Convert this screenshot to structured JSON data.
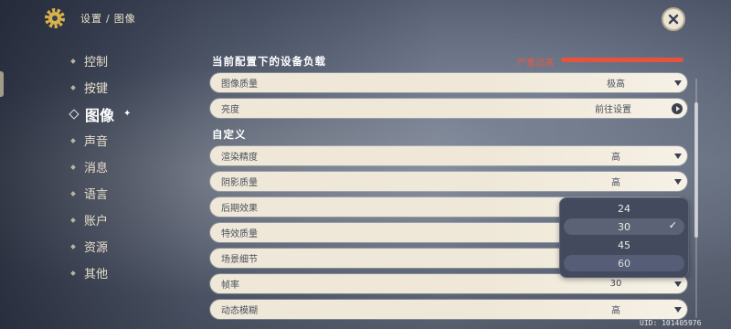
{
  "header": {
    "breadcrumb": [
      "设置",
      "图像"
    ],
    "separator": "/"
  },
  "nav": {
    "items": [
      {
        "label": "控制"
      },
      {
        "label": "按键"
      },
      {
        "label": "图像",
        "active": true
      },
      {
        "label": "声音"
      },
      {
        "label": "消息"
      },
      {
        "label": "语言"
      },
      {
        "label": "账户"
      },
      {
        "label": "资源"
      },
      {
        "label": "其他"
      }
    ]
  },
  "device_load": {
    "title": "当前配置下的设备负载",
    "status": "严重过高",
    "color": "#e5533f"
  },
  "settings": [
    {
      "label": "图像质量",
      "value": "极高",
      "control": "dropdown"
    },
    {
      "label": "亮度",
      "value": "前往设置",
      "control": "go"
    }
  ],
  "custom": {
    "title": "自定义",
    "rows": [
      {
        "label": "渲染精度",
        "value": "高",
        "control": "dropdown"
      },
      {
        "label": "阴影质量",
        "value": "高",
        "control": "dropdown"
      },
      {
        "label": "后期效果",
        "value": "",
        "control": "dropdown"
      },
      {
        "label": "特效质量",
        "value": "",
        "control": "dropdown"
      },
      {
        "label": "场景细节",
        "value": "",
        "control": "dropdown"
      },
      {
        "label": "帧率",
        "value": "30",
        "control": "dropdown"
      },
      {
        "label": "动态模糊",
        "value": "高",
        "control": "dropdown"
      }
    ]
  },
  "framerate_dropdown": {
    "options": [
      "24",
      "30",
      "45",
      "60"
    ],
    "selected": "30",
    "highlighted": "60"
  },
  "footer": {
    "uid": "UID: 101405976"
  },
  "icons": {
    "settings": "gear-icon",
    "close": "close-icon",
    "check": "checkmark-icon"
  }
}
